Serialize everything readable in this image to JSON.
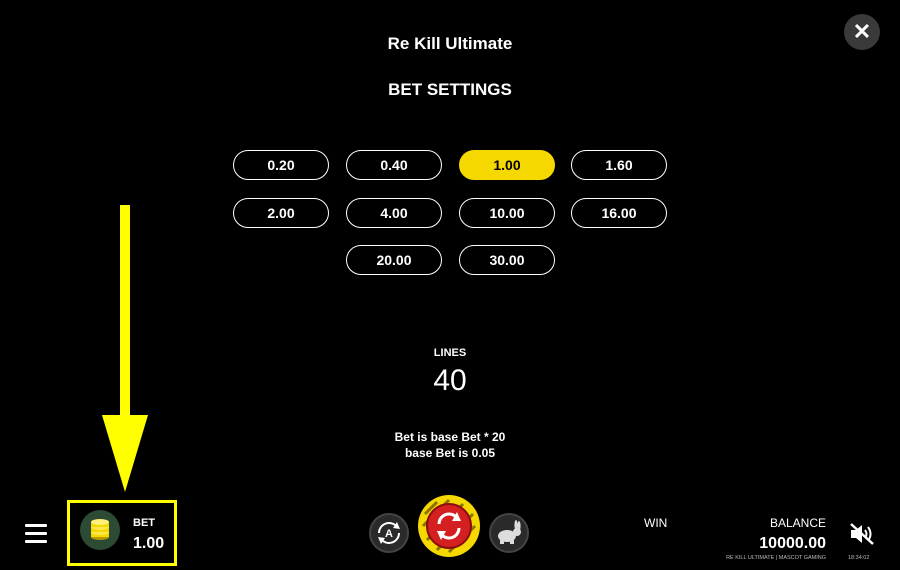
{
  "header": {
    "game_title": "Re Kill Ultimate",
    "section_title": "BET SETTINGS",
    "close_icon": "close-icon"
  },
  "bet_options": [
    {
      "label": "0.20",
      "selected": false
    },
    {
      "label": "0.40",
      "selected": false
    },
    {
      "label": "1.00",
      "selected": true
    },
    {
      "label": "1.60",
      "selected": false
    },
    {
      "label": "2.00",
      "selected": false
    },
    {
      "label": "4.00",
      "selected": false
    },
    {
      "label": "10.00",
      "selected": false
    },
    {
      "label": "16.00",
      "selected": false
    },
    {
      "label": "20.00",
      "selected": false
    },
    {
      "label": "30.00",
      "selected": false
    }
  ],
  "lines": {
    "label": "LINES",
    "value": "40"
  },
  "info": {
    "line1": "Bet is base Bet * 20",
    "line2": "base Bet is 0.05"
  },
  "bottom_bar": {
    "menu_icon": "hamburger-menu-icon",
    "bet_label": "BET",
    "bet_value": "1.00",
    "win_label": "WIN",
    "balance_label": "BALANCE",
    "balance_value": "10000.00",
    "footer": "RE KILL ULTIMATE | MASCOT GAMING",
    "clock": "18:34:02"
  },
  "colors": {
    "accent": "#f5d800",
    "highlight": "#ffff00",
    "background": "#000000",
    "spin_red": "#d42020"
  }
}
